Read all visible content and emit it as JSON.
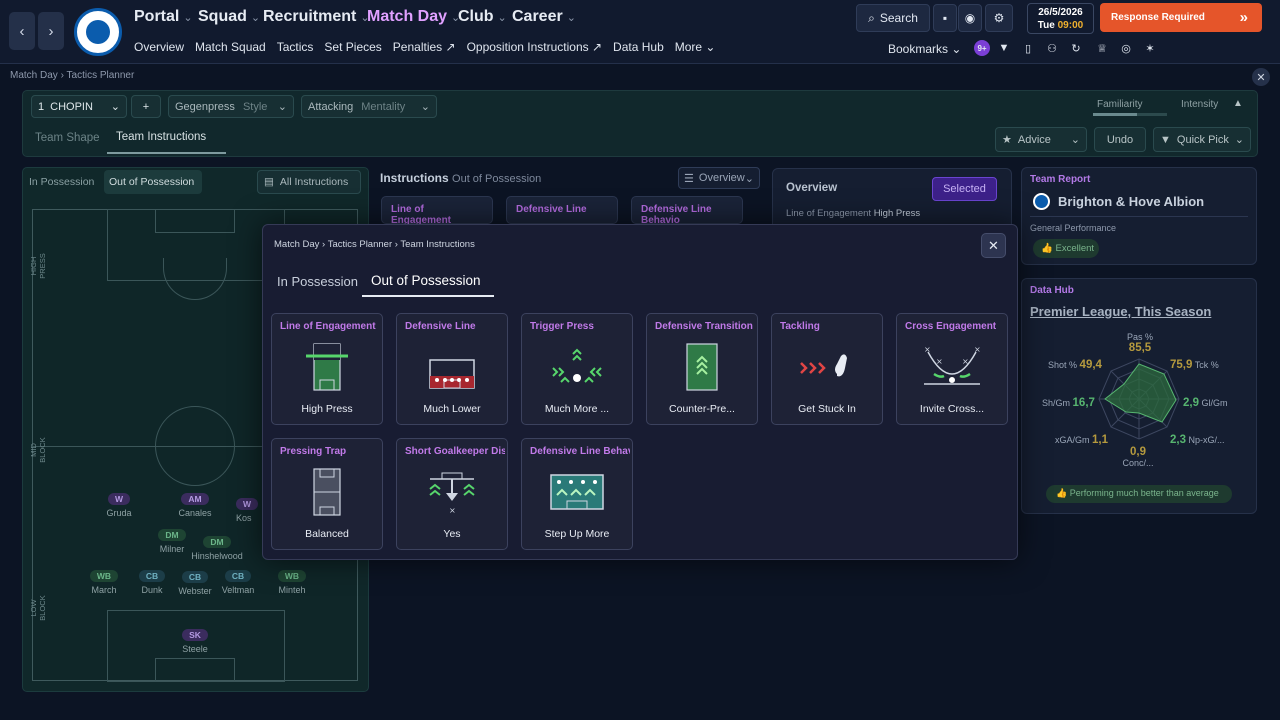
{
  "topbar": {
    "menu": [
      {
        "label": "Portal",
        "active": false
      },
      {
        "label": "Squad",
        "active": false
      },
      {
        "label": "Recruitment",
        "active": false
      },
      {
        "label": "Match Day",
        "active": true
      },
      {
        "label": "Club",
        "active": false
      },
      {
        "label": "Career",
        "active": false
      }
    ],
    "submenu": [
      "Overview",
      "Match Squad",
      "Tactics",
      "Set Pieces",
      "Penalties",
      "Opposition Instructions",
      "Data Hub",
      "More"
    ],
    "search_label": "Search",
    "date": "26/5/2026",
    "day": "Tue",
    "time": "09:00",
    "response_label": "Response Required",
    "bookmarks_label": "Bookmarks",
    "badge": "9+",
    "accent_color": "#e0a0ff",
    "response_color": "#e5552a"
  },
  "breadcrumb": {
    "a": "Match Day",
    "b": "Tactics Planner"
  },
  "tactics": {
    "tactic_num": "1",
    "tactic_name": "CHOPIN",
    "style_value": "Gegenpress",
    "style_label": "Style",
    "mentality_value": "Attacking",
    "mentality_label": "Mentality",
    "familiarity": "Familiarity",
    "intensity": "Intensity",
    "tabs": [
      "Team Shape",
      "Team Instructions"
    ],
    "advice": "Advice",
    "undo": "Undo",
    "quick_pick": "Quick Pick"
  },
  "pitch": {
    "tab_in": "In Possession",
    "tab_out": "Out of Possession",
    "all_instructions": "All Instructions",
    "labels": {
      "high": "HIGH PRESS",
      "mid": "MID BLOCK",
      "low": "LOW BLOCK"
    },
    "players": [
      {
        "pos": "W",
        "name": "Gruda",
        "color": "pur"
      },
      {
        "pos": "AM",
        "name": "Canales",
        "color": "pur"
      },
      {
        "pos": "W",
        "name": "Kos",
        "color": "pur"
      },
      {
        "pos": "DM",
        "name": "Milner",
        "color": "grn"
      },
      {
        "pos": "DM",
        "name": "Hinshelwood",
        "color": "grn"
      },
      {
        "pos": "WB",
        "name": "March",
        "color": "grn"
      },
      {
        "pos": "CB",
        "name": "Dunk",
        "color": "tea"
      },
      {
        "pos": "CB",
        "name": "Webster",
        "color": "tea"
      },
      {
        "pos": "CB",
        "name": "Veltman",
        "color": "tea"
      },
      {
        "pos": "WB",
        "name": "Minteh",
        "color": "grn"
      },
      {
        "pos": "SK",
        "name": "Steele",
        "color": "pur"
      }
    ]
  },
  "instructions": {
    "title": "Instructions",
    "subtitle": "Out of Possession",
    "overview_select": "Overview",
    "cards": [
      "Line of Engagement",
      "Defensive Line",
      "Defensive Line Behavio"
    ]
  },
  "overview": {
    "title": "Overview",
    "selected": "Selected",
    "line": "Line of Engagement",
    "line_value": "High Press"
  },
  "team_report": {
    "title": "Team Report",
    "club": "Brighton & Hove Albion",
    "perf_label": "General Performance",
    "perf_value": "Excellent"
  },
  "data_hub": {
    "title": "Data Hub",
    "scope": "Premier League, This Season",
    "stats": [
      {
        "label": "Pas %",
        "value": "85,5"
      },
      {
        "label": "Tck %",
        "value": "75,9"
      },
      {
        "label": "Gl/Gm",
        "value": "2,9"
      },
      {
        "label": "Np-xG/...",
        "value": "2,3"
      },
      {
        "label": "Conc/...",
        "value": "0,9"
      },
      {
        "label": "xGA/Gm",
        "value": "1,1"
      },
      {
        "label": "Sh/Gm",
        "value": "16,7"
      },
      {
        "label": "Shot %",
        "value": "49,4"
      }
    ],
    "footer": "Performing much better than average"
  },
  "modal": {
    "crumbs": [
      "Match Day",
      "Tactics Planner",
      "Team Instructions"
    ],
    "tabs": [
      "In Possession",
      "Out of Possession"
    ],
    "cards": [
      {
        "title": "Line of Engagement",
        "value": "High Press",
        "icon": "line-of-engagement-icon"
      },
      {
        "title": "Defensive Line",
        "value": "Much Lower",
        "icon": "defensive-line-icon"
      },
      {
        "title": "Trigger Press",
        "value": "Much More ...",
        "icon": "trigger-press-icon"
      },
      {
        "title": "Defensive Transition",
        "value": "Counter-Pre...",
        "icon": "defensive-transition-icon"
      },
      {
        "title": "Tackling",
        "value": "Get Stuck In",
        "icon": "tackling-icon"
      },
      {
        "title": "Cross Engagement",
        "value": "Invite Cross...",
        "icon": "cross-engagement-icon"
      },
      {
        "title": "Pressing Trap",
        "value": "Balanced",
        "icon": "pressing-trap-icon"
      },
      {
        "title": "Short Goalkeeper Distr",
        "value": "Yes",
        "icon": "goalkeeper-distribution-icon"
      },
      {
        "title": "Defensive Line Behavic",
        "value": "Step Up More",
        "icon": "defensive-line-behaviour-icon"
      }
    ]
  }
}
